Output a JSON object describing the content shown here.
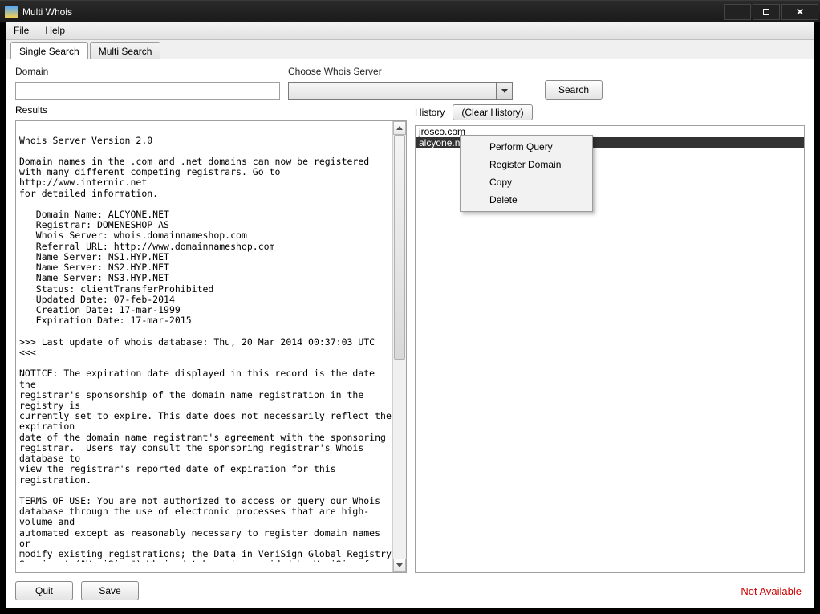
{
  "window": {
    "title": "Multi Whois"
  },
  "menubar": {
    "file": "File",
    "help": "Help"
  },
  "tabs": {
    "single": "Single Search",
    "multi": "Multi Search"
  },
  "labels": {
    "domain": "Domain",
    "choose_server": "Choose Whois Server",
    "results": "Results",
    "history": "History"
  },
  "buttons": {
    "search": "Search",
    "clear_history": "(Clear History)",
    "quit": "Quit",
    "save": "Save"
  },
  "domain_value": "",
  "server_value": "",
  "history_items": [
    "jrosco.com",
    "alcyone.net"
  ],
  "history_selected_index": 1,
  "context_menu": {
    "perform": "Perform Query",
    "register": "Register Domain",
    "copy": "Copy",
    "delete": "Delete"
  },
  "status": "Not Available",
  "results_text": "Whois Server Version 2.0\n\nDomain names in the .com and .net domains can now be registered\nwith many different competing registrars. Go to http://www.internic.net\nfor detailed information.\n\n   Domain Name: ALCYONE.NET\n   Registrar: DOMENESHOP AS\n   Whois Server: whois.domainnameshop.com\n   Referral URL: http://www.domainnameshop.com\n   Name Server: NS1.HYP.NET\n   Name Server: NS2.HYP.NET\n   Name Server: NS3.HYP.NET\n   Status: clientTransferProhibited\n   Updated Date: 07-feb-2014\n   Creation Date: 17-mar-1999\n   Expiration Date: 17-mar-2015\n\n>>> Last update of whois database: Thu, 20 Mar 2014 00:37:03 UTC <<<\n\nNOTICE: The expiration date displayed in this record is the date the\nregistrar's sponsorship of the domain name registration in the registry is\ncurrently set to expire. This date does not necessarily reflect the expiration\ndate of the domain name registrant's agreement with the sponsoring\nregistrar.  Users may consult the sponsoring registrar's Whois database to\nview the registrar's reported date of expiration for this registration.\n\nTERMS OF USE: You are not authorized to access or query our Whois\ndatabase through the use of electronic processes that are high-volume and\nautomated except as reasonably necessary to register domain names or\nmodify existing registrations; the Data in VeriSign Global Registry\nServices' (\"VeriSign\") Whois database is provided by VeriSign for\ninformation purposes only, and to assist persons in obtaining information\nabout or related to a domain name registration record. VeriSign does not\nguarantee its accuracy. By submitting a Whois query, you agree to abide\nby the following terms of use: You agree that you may use this Data only\nfor lawful purposes and that under no circumstances will you use this Data\nto: (1) allow, enable, or otherwise support the transmission of mass\nunsolicited, commercial advertising or solicitations via e-mail, telephone,\nor facsimile; or (2) enable high volume, automated, electronic processes\nthat apply to VeriSign (or its computer systems). The compilation,"
}
